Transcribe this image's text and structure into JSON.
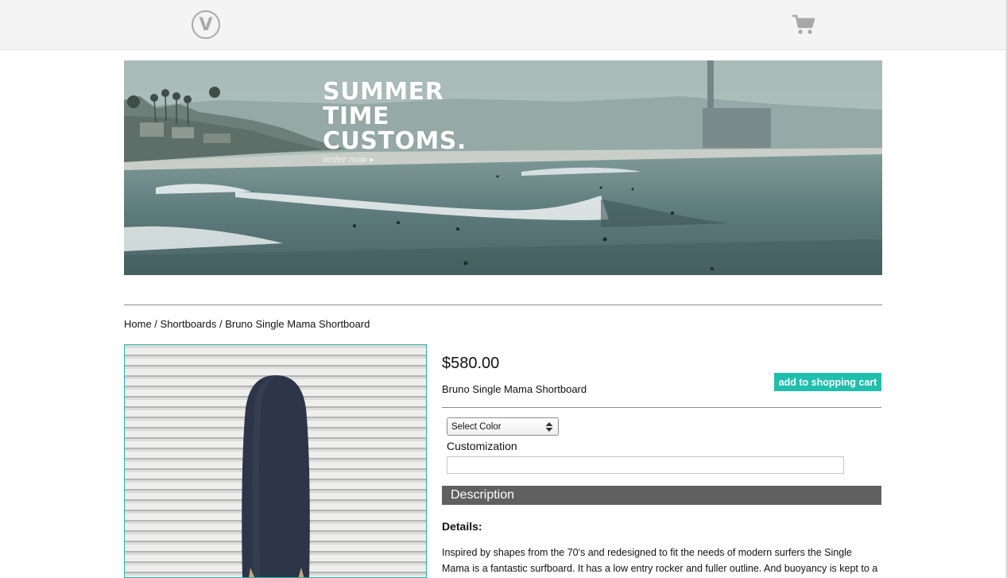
{
  "header": {
    "logo_letter": "V",
    "cart_icon": "shopping-cart-icon"
  },
  "banner": {
    "headline_lines": [
      "SUMMER",
      "TIME",
      "CUSTOMS."
    ],
    "cta": "order now ▸"
  },
  "breadcrumb": {
    "home": "Home",
    "sep1": " / ",
    "category": "Shortboards",
    "sep2": " / ",
    "current": "Bruno Single Mama Shortboard"
  },
  "product": {
    "price": "$580.00",
    "name": "Bruno Single Mama Shortboard",
    "add_to_cart_label": "add to shopping cart",
    "color_select": {
      "selected": "Select Color"
    },
    "customization_label": "Customization",
    "customization_value": "",
    "description_header": "Description",
    "details_title": "Details:",
    "details_text": "Inspired by shapes from the 70's and redesigned to fit the needs of modern surfers the Single Mama is a fantastic surfboard. It has a low entry rocker and fuller outline. And buoyancy is kept to a"
  },
  "colors": {
    "accent": "#1fbfae",
    "description_bar": "#606060",
    "board": "#2d3648"
  }
}
